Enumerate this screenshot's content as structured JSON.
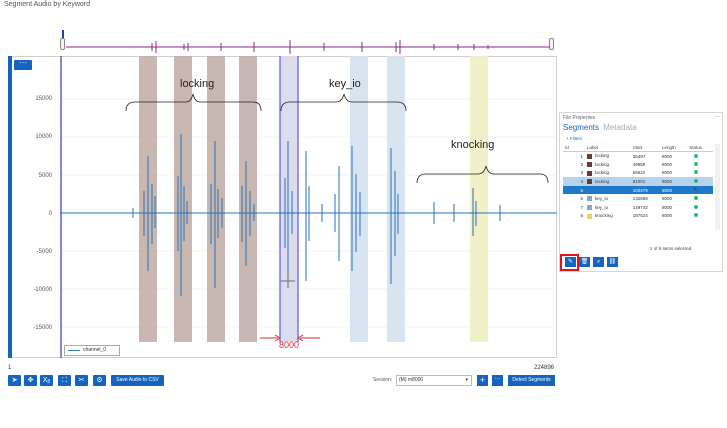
{
  "window": {
    "title": "Segment Audio by Keyword"
  },
  "overview": {},
  "plot": {
    "y_ticks": [
      "15000",
      "10000",
      "5000",
      "0",
      "-5000",
      "-10000",
      "-15000"
    ],
    "x_start": "1",
    "x_end": "224896",
    "legend": "channel_0",
    "segment_colors": {
      "locking": "#8b6b62",
      "key_io": "#9ab6cf",
      "knocking": "#e9e8a8",
      "selected": "#6d6fd8",
      "waveform": "#2a70b8"
    }
  },
  "annotations": {
    "locking": "locking",
    "key_io": "key_io",
    "knocking": "knocking",
    "length_8000": "8000"
  },
  "toolbar": {
    "menu_label": "···",
    "save_label": "Save Audio to CSV",
    "session_label": "Session:",
    "session_value": "(M) m8000",
    "detect_label": "Detect Segments",
    "tools": [
      {
        "icon": "pointer-icon",
        "glyph": "➤"
      },
      {
        "icon": "move-icon",
        "glyph": "✥"
      },
      {
        "icon": "x-axis-zoom-icon",
        "glyph": "Xᵦ"
      },
      {
        "icon": "fit-icon",
        "glyph": "⛶"
      },
      {
        "icon": "cut-icon",
        "glyph": "✂"
      },
      {
        "icon": "settings-icon",
        "glyph": "⚙"
      }
    ]
  },
  "file_properties": {
    "title": "File Properties",
    "tab_segments": "Segments",
    "tab_metadata": "Metadata",
    "filter_label": "+ Filters",
    "columns": [
      "Id",
      "Label",
      "Start",
      "Length",
      "Status"
    ],
    "rows": [
      {
        "id": "1",
        "label": "locking",
        "start": "35497",
        "length": "8000",
        "color": "#6b3a37"
      },
      {
        "id": "2",
        "label": "locking",
        "start": "49959",
        "length": "8000",
        "color": "#6b3a37"
      },
      {
        "id": "3",
        "label": "locking",
        "start": "66622",
        "length": "8000",
        "color": "#6b3a37"
      },
      {
        "id": "4",
        "label": "locking",
        "start": "81001",
        "length": "8000",
        "color": "#6b3a37"
      },
      {
        "id": "5",
        "label": "",
        "start": "100479",
        "length": "8000",
        "color": ""
      },
      {
        "id": "6",
        "label": "key_io",
        "start": "132869",
        "length": "8000",
        "color": "#7ea9d0"
      },
      {
        "id": "7",
        "label": "key_io",
        "start": "149742",
        "length": "8000",
        "color": "#7ea9d0"
      },
      {
        "id": "8",
        "label": "knocking",
        "start": "187524",
        "length": "8000",
        "color": "#dcdc66"
      }
    ],
    "selection_status": "1 of 8 items selected"
  }
}
